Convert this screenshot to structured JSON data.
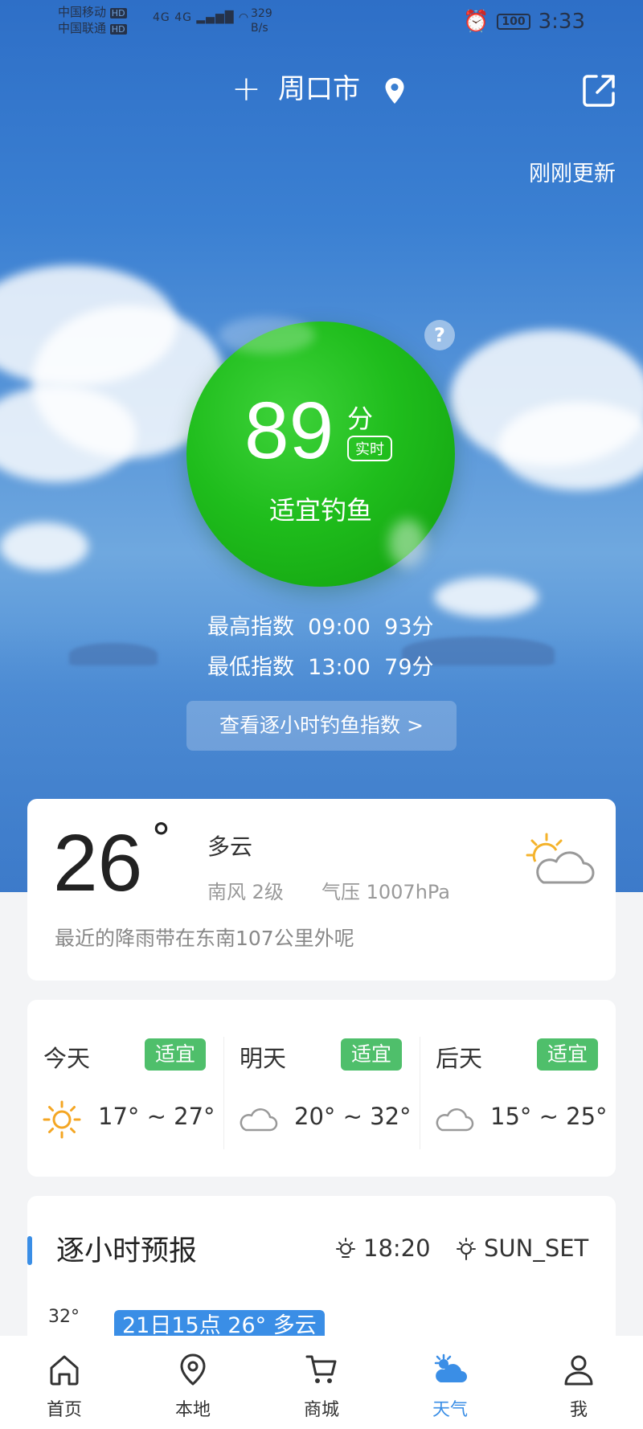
{
  "status_bar": {
    "carrier1": "中国移动",
    "carrier2": "中国联通",
    "hd1": "HD",
    "hd2": "HD",
    "signal": "4G 4G",
    "speed_value": "329",
    "speed_unit": "B/s",
    "battery": "100",
    "time": "3:33"
  },
  "header": {
    "add_symbol": "+",
    "city": "周口市",
    "updated": "刚刚更新"
  },
  "score": {
    "value": "89",
    "unit": "分",
    "realtime_badge": "实时",
    "verdict": "适宜钓鱼",
    "help_symbol": "?",
    "color": "#1fbd1c"
  },
  "index": {
    "highest": {
      "label": "最高指数",
      "time": "09:00",
      "score": "93分"
    },
    "lowest": {
      "label": "最低指数",
      "time": "13:00",
      "score": "79分"
    },
    "hourly_button": "查看逐小时钓鱼指数 >"
  },
  "current": {
    "temp": "26",
    "degree": "°",
    "condition": "多云",
    "wind": "南风  2级",
    "pressure": "气压  1007hPa",
    "rain_message": "最近的降雨带在东南107公里外呢",
    "icon": "partly-cloudy-icon"
  },
  "forecast": [
    {
      "day": "今天",
      "badge": "适宜",
      "range": "17° ~ 27°",
      "icon": "sun-icon"
    },
    {
      "day": "明天",
      "badge": "适宜",
      "range": "20° ~ 32°",
      "icon": "cloud-icon"
    },
    {
      "day": "后天",
      "badge": "适宜",
      "range": "15° ~ 25°",
      "icon": "cloud-icon"
    }
  ],
  "hourly": {
    "title": "逐小时预报",
    "sunrise_time": "18:20",
    "sunset_label": "SUN_SET",
    "top_temp": "32°",
    "tag": "21日15点 26° 多云"
  },
  "tabs": [
    {
      "label": "首页",
      "icon": "home-icon",
      "active": false
    },
    {
      "label": "本地",
      "icon": "location-icon",
      "active": false
    },
    {
      "label": "商城",
      "icon": "cart-icon",
      "active": false
    },
    {
      "label": "天气",
      "icon": "weather-icon",
      "active": true
    },
    {
      "label": "我",
      "icon": "profile-icon",
      "active": false
    }
  ],
  "colors": {
    "accent": "#3a8ee6",
    "suitable_badge": "#4fbf6b"
  }
}
